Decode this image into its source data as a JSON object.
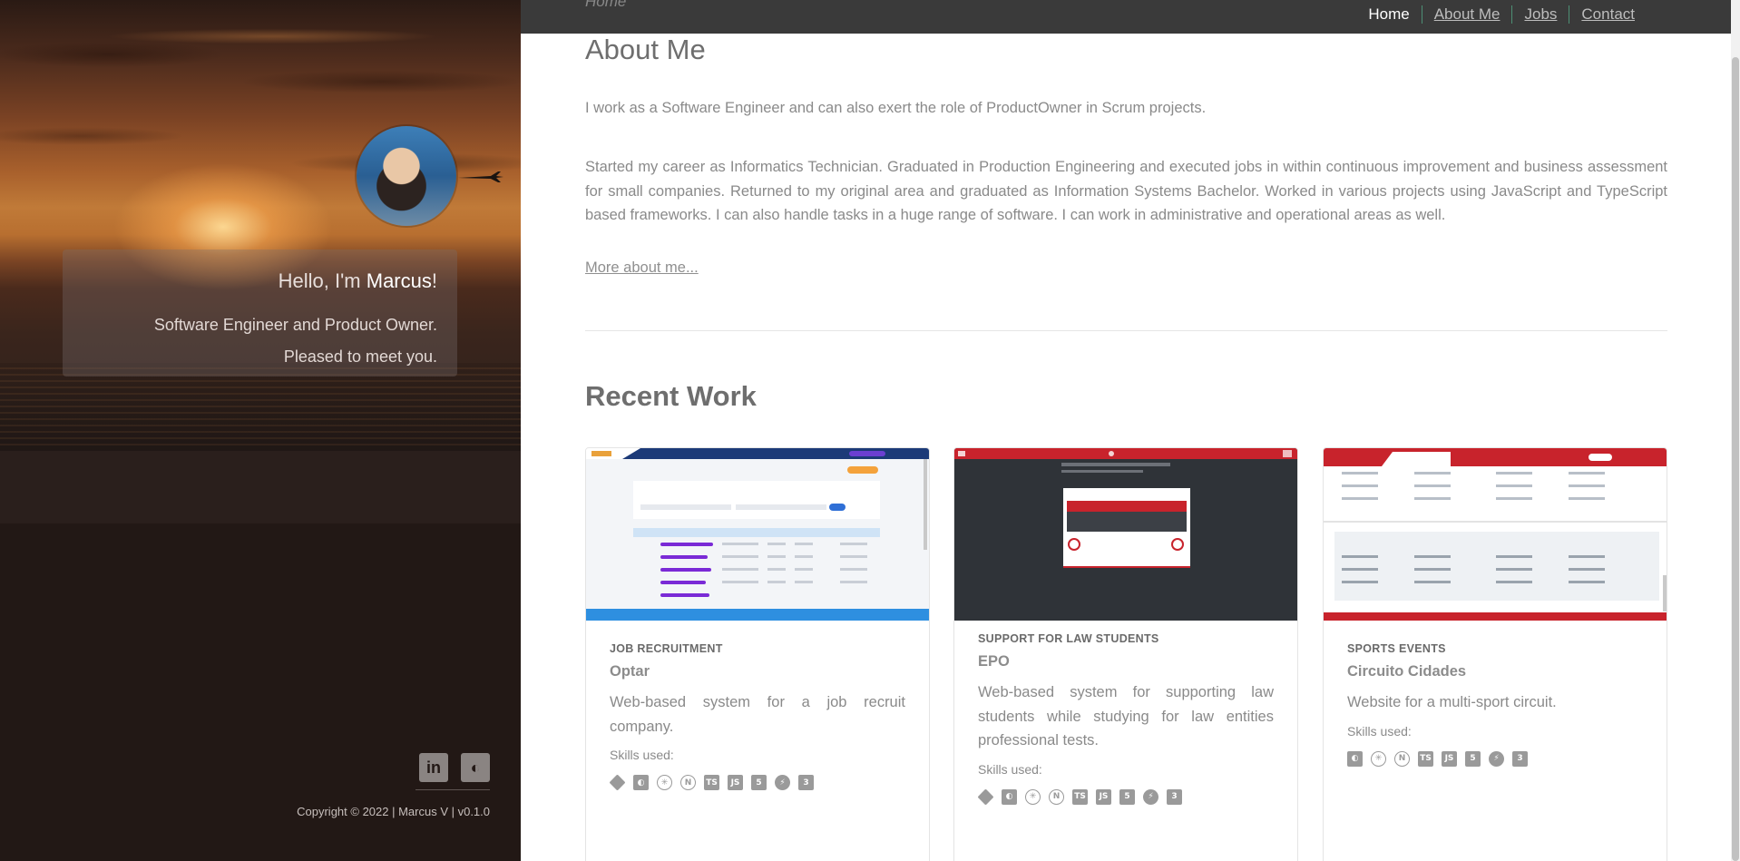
{
  "sidebar": {
    "hello_prefix": "Hello, I'm ",
    "name": "Marcus",
    "hello_suffix": "!",
    "role_line1": "Software Engineer and Product Owner.",
    "role_line2": "Pleased to meet you.",
    "social": [
      {
        "icon": "linkedin-icon",
        "glyph": "in"
      },
      {
        "icon": "github-icon",
        "glyph": "◐"
      }
    ],
    "copyright": "Copyright © 2022 | Marcus V | v0.1.0"
  },
  "nav": {
    "breadcrumb": "Home",
    "items": [
      "Home",
      "About Me",
      "Jobs",
      "Contact"
    ]
  },
  "about": {
    "title": "About Me",
    "p1": "I work as a Software Engineer and can also exert the role of ProductOwner in Scrum projects.",
    "p2": "Started my career as Informatics Technician. Graduated in Production Engineering and executed jobs in within continuous improvement and business assessment for small companies. Returned to my original area and graduated as Information Systems Bachelor. Worked in various projects using JavaScript and TypeScript based frameworks. I can also handle tasks in a huge range of software. I can work in administrative and operational areas as well.",
    "more_link": "More about me..."
  },
  "recent": {
    "title": "Recent Work",
    "skills_label": "Skills used:",
    "cards": [
      {
        "category": "JOB RECRUITMENT",
        "title": "Optar",
        "desc": "Web-based system for a job recruit company.",
        "skills": [
          "git-icon",
          "github-icon",
          "react-icon",
          "nextjs-icon",
          "typescript-icon",
          "javascript-icon",
          "html-icon",
          "supabase-icon",
          "css-icon"
        ]
      },
      {
        "category": "SUPPORT FOR LAW STUDENTS",
        "title": "EPO",
        "desc": "Web-based system for supporting law students while studying for law entities professional tests.",
        "skills": [
          "git-icon",
          "github-icon",
          "react-icon",
          "nextjs-icon",
          "typescript-icon",
          "javascript-icon",
          "html-icon",
          "supabase-icon",
          "css-icon"
        ]
      },
      {
        "category": "SPORTS EVENTS",
        "title": "Circuito Cidades",
        "desc": "Website for a multi-sport circuit.",
        "skills": [
          "github-icon",
          "react-icon",
          "nextjs-icon",
          "typescript-icon",
          "javascript-icon",
          "html-icon",
          "supabase-icon",
          "css-icon"
        ]
      }
    ]
  },
  "colors": {
    "sidebar_bg": "#221815",
    "nav_bg": "#3a3a3a",
    "nav_divider": "#4d8f74",
    "text": "#8a8a8a"
  }
}
